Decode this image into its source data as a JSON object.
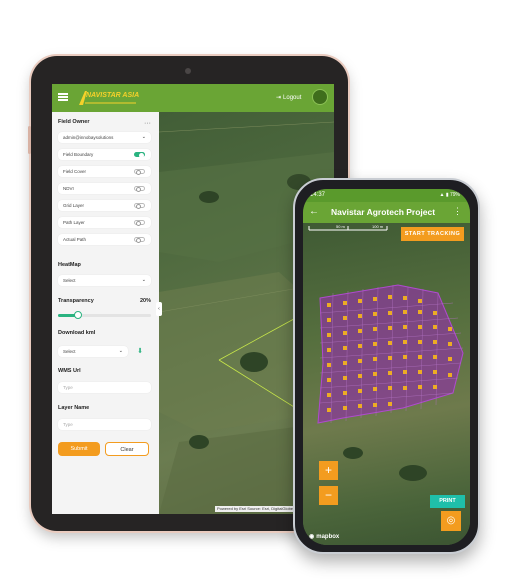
{
  "tablet": {
    "brand": "NAVISTAR ASIA",
    "logout_label": "Logout",
    "panel": {
      "field_owner_label": "Field Owner",
      "owner_value": "admin@innobaysolutions",
      "layers": [
        {
          "label": "Field Boundary",
          "on": true
        },
        {
          "label": "Field Cover",
          "on": false
        },
        {
          "label": "NDVI",
          "on": false
        },
        {
          "label": "Grid Layer",
          "on": false
        },
        {
          "label": "Path Layer",
          "on": false
        },
        {
          "label": "Actual Path",
          "on": false
        }
      ],
      "heatmap_label": "HeatMap",
      "heatmap_select": "Select",
      "transparency_label": "Transparency",
      "transparency_value": "20%",
      "transparency_fraction": 0.2,
      "download_label": "Download kml",
      "download_select": "Select",
      "wms_label": "WMS Url",
      "wms_placeholder": "Type",
      "layer_name_label": "Layer Name",
      "layer_name_placeholder": "Type",
      "submit_label": "Submit",
      "clear_label": "Clear"
    },
    "attribution": "Powered by Esri Source: Esri, DigitalGlobe"
  },
  "phone": {
    "time": "14:37",
    "status_right": "79%",
    "title": "Navistar Agrotech Project",
    "scale_label_1": "50 m",
    "scale_label_2": "100 m",
    "start_tracking_label": "START TRACKING",
    "print_label": "PRINT",
    "zoom_in_label": "+",
    "zoom_out_label": "−",
    "mapbox_label": "mapbox"
  },
  "colors": {
    "brand_green": "#6aa535",
    "accent_orange": "#f39c1f",
    "toggle_teal": "#2ab380",
    "grid_purple": "#8a3a9a",
    "print_teal": "#1fbfaa"
  }
}
